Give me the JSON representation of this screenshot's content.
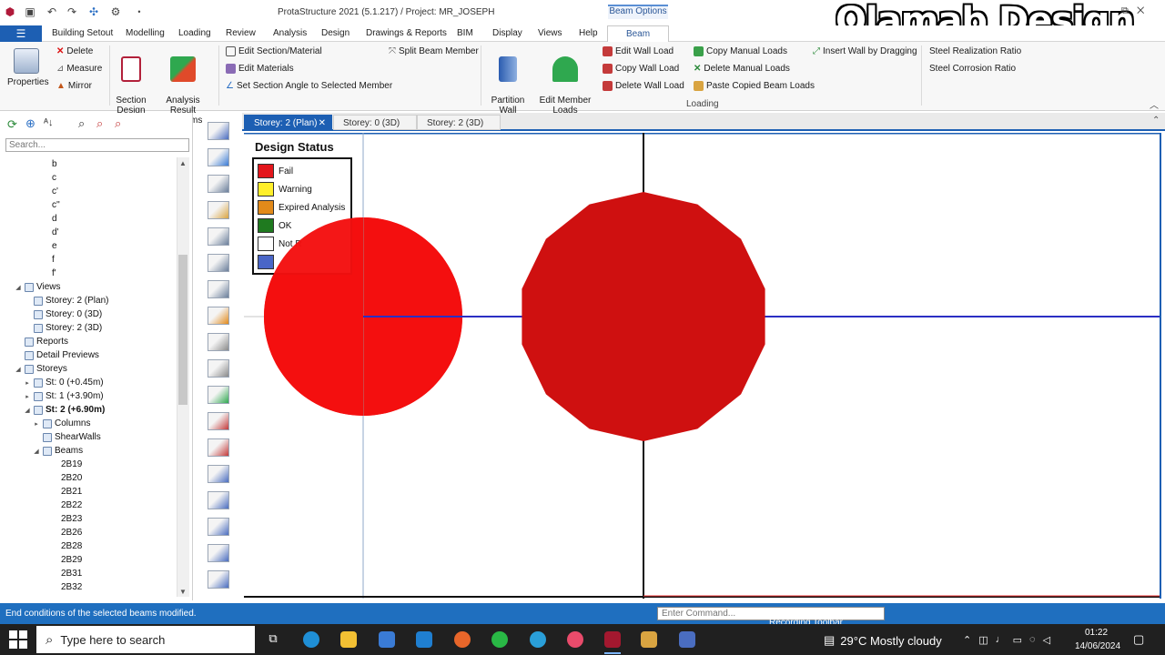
{
  "window": {
    "title": "ProtaStructure 2021 (5.1.217) / Project: MR_JOSEPH",
    "context_group": "Beam Options",
    "watermark": "Olamab Design"
  },
  "menu": {
    "items": [
      "Building Setout",
      "Modelling",
      "Loading",
      "Review",
      "Analysis",
      "Design",
      "Drawings & Reports",
      "BIM",
      "Display",
      "Views",
      "Help"
    ],
    "active_tab": "Beam"
  },
  "ribbon": {
    "properties": "Properties",
    "delete": "Delete",
    "measure": "Measure",
    "mirror": "Mirror",
    "section_design": "Section\nDesign",
    "analysis_result": "Analysis Result\nDiagrams",
    "edit_section_material": "Edit Section/Material",
    "edit_materials": "Edit Materials",
    "set_section_angle": "Set Section Angle to Selected Member",
    "split_beam_member": "Split Beam Member",
    "partition_wall_loads": "Partition\nWall Loads",
    "edit_member_loads": "Edit Member\nLoads",
    "edit_wall_load": "Edit Wall Load",
    "copy_wall_load": "Copy Wall Load",
    "delete_wall_load": "Delete Wall Load",
    "copy_manual_loads": "Copy Manual Loads",
    "delete_manual_loads": "Delete Manual Loads",
    "paste_copied_beam_loads": "Paste Copied Beam Loads",
    "insert_wall_by_dragging": "Insert Wall by Dragging",
    "steel_realization_ratio": "Steel Realization Ratio",
    "steel_corrosion_ratio": "Steel Corrosion Ratio",
    "group_loading": "Loading"
  },
  "left_panel": {
    "search_placeholder": "Search...",
    "tree": [
      {
        "label": "b",
        "indent": 4,
        "icon": false,
        "bold": false
      },
      {
        "label": "c",
        "indent": 4,
        "icon": false,
        "bold": false
      },
      {
        "label": "c'",
        "indent": 4,
        "icon": false,
        "bold": false
      },
      {
        "label": "c''",
        "indent": 4,
        "icon": false,
        "bold": false
      },
      {
        "label": "d",
        "indent": 4,
        "icon": false,
        "bold": false
      },
      {
        "label": "d'",
        "indent": 4,
        "icon": false,
        "bold": false
      },
      {
        "label": "e",
        "indent": 4,
        "icon": false,
        "bold": false
      },
      {
        "label": "f",
        "indent": 4,
        "icon": false,
        "bold": false
      },
      {
        "label": "f'",
        "indent": 4,
        "icon": false,
        "bold": false
      },
      {
        "label": "Views",
        "indent": 1,
        "icon": true,
        "bold": false,
        "expander": "◢"
      },
      {
        "label": "Storey: 2 (Plan)",
        "indent": 2,
        "icon": true,
        "bold": false
      },
      {
        "label": "Storey: 0 (3D)",
        "indent": 2,
        "icon": true,
        "bold": false
      },
      {
        "label": "Storey: 2 (3D)",
        "indent": 2,
        "icon": true,
        "bold": false
      },
      {
        "label": "Reports",
        "indent": 1,
        "icon": true,
        "bold": false
      },
      {
        "label": "Detail Previews",
        "indent": 1,
        "icon": true,
        "bold": false
      },
      {
        "label": "Storeys",
        "indent": 1,
        "icon": true,
        "bold": false,
        "expander": "◢"
      },
      {
        "label": "St: 0 (+0.45m)",
        "indent": 2,
        "icon": true,
        "bold": false,
        "expander": "▸"
      },
      {
        "label": "St: 1 (+3.90m)",
        "indent": 2,
        "icon": true,
        "bold": false,
        "expander": "▸"
      },
      {
        "label": "St: 2 (+6.90m)",
        "indent": 2,
        "icon": true,
        "bold": true,
        "expander": "◢"
      },
      {
        "label": "Columns",
        "indent": 3,
        "icon": true,
        "bold": false,
        "expander": "▸"
      },
      {
        "label": "ShearWalls",
        "indent": 3,
        "icon": true,
        "bold": false
      },
      {
        "label": "Beams",
        "indent": 3,
        "icon": true,
        "bold": false,
        "expander": "◢"
      },
      {
        "label": "2B19",
        "indent": 5,
        "icon": false,
        "bold": false
      },
      {
        "label": "2B20",
        "indent": 5,
        "icon": false,
        "bold": false
      },
      {
        "label": "2B21",
        "indent": 5,
        "icon": false,
        "bold": false
      },
      {
        "label": "2B22",
        "indent": 5,
        "icon": false,
        "bold": false
      },
      {
        "label": "2B23",
        "indent": 5,
        "icon": false,
        "bold": false
      },
      {
        "label": "2B26",
        "indent": 5,
        "icon": false,
        "bold": false
      },
      {
        "label": "2B28",
        "indent": 5,
        "icon": false,
        "bold": false
      },
      {
        "label": "2B29",
        "indent": 5,
        "icon": false,
        "bold": false
      },
      {
        "label": "2B31",
        "indent": 5,
        "icon": false,
        "bold": false
      },
      {
        "label": "2B32",
        "indent": 5,
        "icon": false,
        "bold": false
      }
    ]
  },
  "doc_tabs": [
    "Storey: 2 (Plan)",
    "Storey: 0 (3D)",
    "Storey: 2 (3D)"
  ],
  "legend": {
    "title": "Design Status",
    "items": [
      {
        "label": "Fail",
        "color": "#e3161c"
      },
      {
        "label": "Warning",
        "color": "#ffef2a"
      },
      {
        "label": "Expired Analysis",
        "color": "#e28a1a"
      },
      {
        "label": "OK",
        "color": "#1f7a1f"
      },
      {
        "label": "Not R",
        "color": "#ffffff"
      },
      {
        "label": "",
        "color": "#4a66c7"
      }
    ]
  },
  "colors": {
    "fail_column": "#f40f0f",
    "fail_column_dark": "#cf1010",
    "beam_line": "#2b2fc4",
    "accent": "#1d5fb3"
  },
  "status": {
    "message": "End conditions of the selected beams modified.",
    "command_placeholder": "Enter Command...",
    "recording": "Recording Toolbar"
  },
  "taskbar": {
    "search_placeholder": "Type here to search",
    "weather": "29°C  Mostly cloudy",
    "time": "01:22",
    "date": "14/06/2024"
  }
}
